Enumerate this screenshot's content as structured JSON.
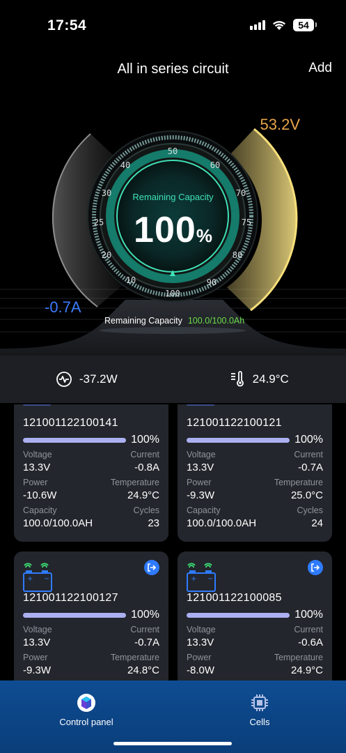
{
  "status": {
    "time": "17:54",
    "battery": "54"
  },
  "nav": {
    "title": "All in series circuit",
    "add_label": "Add"
  },
  "gauge": {
    "voltage": "53.2V",
    "current": "-0.7A",
    "center_label": "Remaining Capacity",
    "percent": "100",
    "percent_sign": "%",
    "scale": [
      "10",
      "20",
      "25",
      "30",
      "40",
      "50",
      "60",
      "70",
      "75",
      "80",
      "90",
      "100"
    ],
    "remaining_label": "Remaining Capacity",
    "remaining_value": "100.0/100.0Ah",
    "colors": {
      "accent": "#3fe0b6",
      "voltage": "#e8a54a",
      "current": "#3c7bff",
      "remaining": "#6bdc4a"
    }
  },
  "stats": {
    "power": "-37.2W",
    "temperature": "24.9°C"
  },
  "labels": {
    "voltage": "Voltage",
    "current": "Current",
    "power": "Power",
    "temperature": "Temperature",
    "capacity": "Capacity",
    "cycles": "Cycles"
  },
  "cells": [
    {
      "id": "121001122100141",
      "percent": "100%",
      "voltage": "13.3V",
      "current": "-0.8A",
      "power": "-10.6W",
      "temperature": "24.9°C",
      "capacity": "100.0/100.0AH",
      "cycles": "23"
    },
    {
      "id": "121001122100121",
      "percent": "100%",
      "voltage": "13.3V",
      "current": "-0.7A",
      "power": "-9.3W",
      "temperature": "25.0°C",
      "capacity": "100.0/100.0AH",
      "cycles": "24"
    },
    {
      "id": "121001122100127",
      "percent": "100%",
      "voltage": "13.3V",
      "current": "-0.7A",
      "power": "-9.3W",
      "temperature": "24.8°C"
    },
    {
      "id": "121001122100085",
      "percent": "100%",
      "voltage": "13.3V",
      "current": "-0.6A",
      "power": "-8.0W",
      "temperature": "24.9°C"
    }
  ],
  "tabs": {
    "control_panel": "Control panel",
    "cells": "Cells"
  }
}
